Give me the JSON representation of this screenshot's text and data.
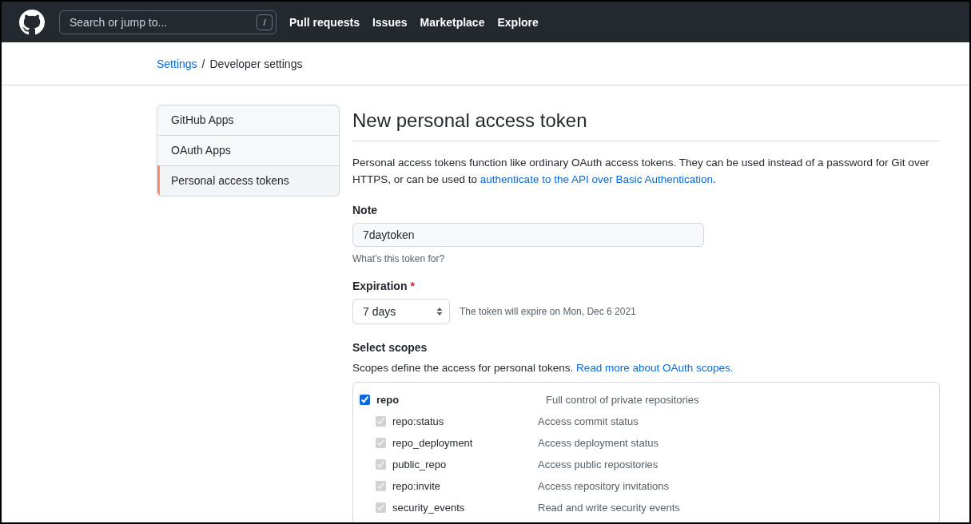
{
  "header": {
    "search": {
      "placeholder": "Search or jump to...",
      "shortcut": "/"
    },
    "nav": [
      "Pull requests",
      "Issues",
      "Marketplace",
      "Explore"
    ]
  },
  "breadcrumb": {
    "link": "Settings",
    "separator": "/",
    "current": "Developer settings"
  },
  "sidebar": {
    "items": [
      {
        "label": "GitHub Apps",
        "selected": false
      },
      {
        "label": "OAuth Apps",
        "selected": false
      },
      {
        "label": "Personal access tokens",
        "selected": true
      }
    ]
  },
  "main": {
    "title": "New personal access token",
    "intro": {
      "before": "Personal access tokens function like ordinary OAuth access tokens. They can be used instead of a password for Git over HTTPS, or can be used to ",
      "link": "authenticate to the API over Basic Authentication",
      "after": "."
    },
    "note": {
      "label": "Note",
      "value": "7daytoken",
      "hint": "What’s this token for?"
    },
    "expiration": {
      "label": "Expiration",
      "required_mark": "*",
      "value": "7 days",
      "hint": "The token will expire on Mon, Dec 6 2021"
    },
    "scopes": {
      "heading": "Select scopes",
      "text": "Scopes define the access for personal tokens. ",
      "link": "Read more about OAuth scopes.",
      "items": [
        {
          "name": "repo",
          "description": "Full control of private repositories",
          "checked": true,
          "disabled": false,
          "children": [
            {
              "name": "repo:status",
              "description": "Access commit status",
              "checked": true,
              "disabled": true
            },
            {
              "name": "repo_deployment",
              "description": "Access deployment status",
              "checked": true,
              "disabled": true
            },
            {
              "name": "public_repo",
              "description": "Access public repositories",
              "checked": true,
              "disabled": true
            },
            {
              "name": "repo:invite",
              "description": "Access repository invitations",
              "checked": true,
              "disabled": true
            },
            {
              "name": "security_events",
              "description": "Read and write security events",
              "checked": true,
              "disabled": true
            }
          ]
        }
      ]
    }
  }
}
